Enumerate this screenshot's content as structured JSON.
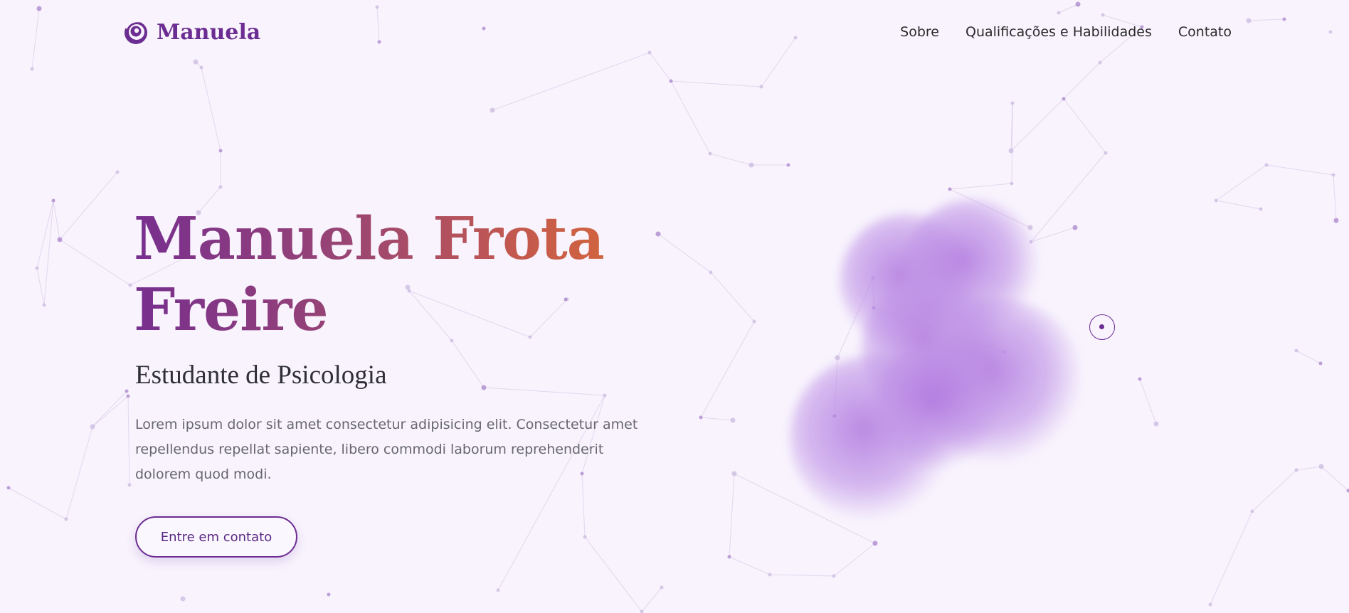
{
  "brand": {
    "name": "Manuela",
    "logo_icon": "spiral-logo-icon",
    "color": "#6b2d91"
  },
  "nav": {
    "items": [
      {
        "label": "Sobre"
      },
      {
        "label": "Qualificações e Habilidades"
      },
      {
        "label": "Contato"
      }
    ]
  },
  "hero": {
    "title_line1": "Manuela Frota",
    "title_line2": "Freire",
    "title_gradient": [
      "#772f8f",
      "#dc6c33"
    ],
    "subtitle": "Estudante de Psicologia",
    "description": "Lorem ipsum dolor sit amet consectetur adipisicing elit. Consectetur amet repellendus repellat sapiente, libero commodi laborum reprehenderit dolorem quod modi.",
    "cta_label": "Entre em contato"
  },
  "theme": {
    "background": "#f8f3fd",
    "accent": "#6b2d91",
    "blob_color": "#b078de"
  }
}
